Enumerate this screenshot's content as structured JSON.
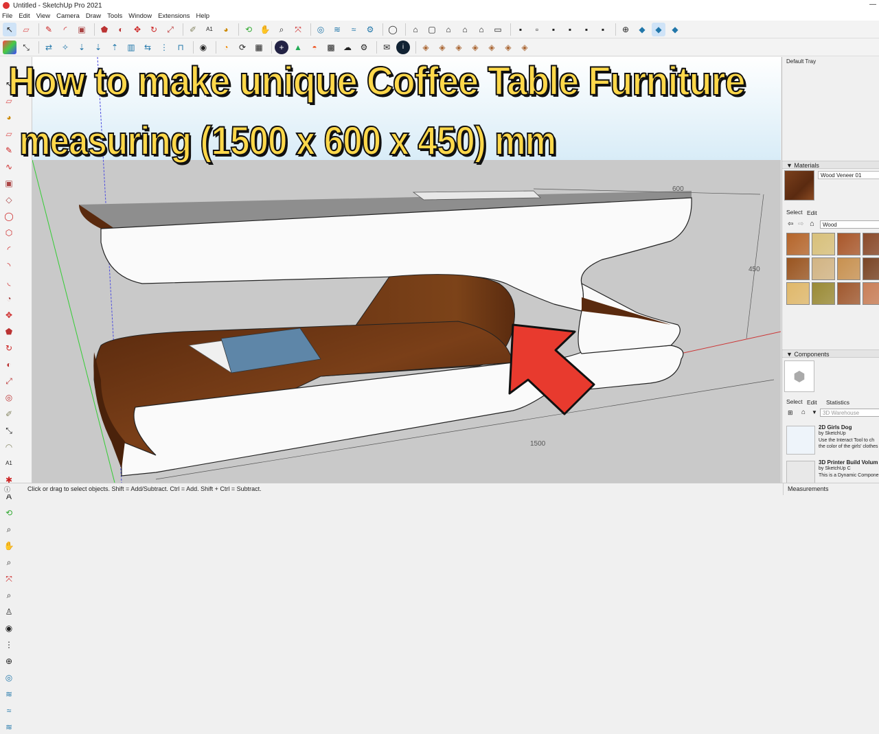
{
  "window": {
    "title": "Untitled - SketchUp Pro 2021"
  },
  "menu": [
    "File",
    "Edit",
    "View",
    "Camera",
    "Draw",
    "Tools",
    "Window",
    "Extensions",
    "Help"
  ],
  "headline": {
    "line1": "How to make unique Coffee Table Furniture",
    "line2": "measuring (1500 x 600 x 450) mm"
  },
  "dimensions": {
    "width": "1500",
    "depth": "600",
    "height": "450"
  },
  "tray": {
    "title": "Default Tray",
    "materials": {
      "header": "Materials",
      "current": "Wood Veneer 01",
      "tabs": [
        "Select",
        "Edit"
      ],
      "search": "Wood",
      "swatches": [
        "#b5652a",
        "#d8c07a",
        "#a9572a",
        "#8a4a2a",
        "#9a5520",
        "#d2b483",
        "#c89150",
        "#7a4526",
        "#e0b86a",
        "#9a8a35",
        "#a0582e",
        "#c97f58"
      ]
    },
    "components": {
      "header": "Components",
      "tabs": [
        "Select",
        "Edit",
        "Statistics"
      ],
      "search_placeholder": "3D Warehouse",
      "items": [
        {
          "title": "2D Girls Dog",
          "by": "by SketchUp",
          "desc": "Use the Interact Tool to ch",
          "desc2": "the color of the girls' clothes"
        },
        {
          "title": "3D Printer Build Volum",
          "by": "by SketchUp C",
          "desc": "This is a Dynamic Compone",
          "desc2": ""
        }
      ]
    }
  },
  "status": {
    "message": "Click or drag to select objects. Shift = Add/Subtract. Ctrl = Add. Shift + Ctrl = Subtract.",
    "measurements_label": "Measurements"
  },
  "colors": {
    "headline": "#ffd84a",
    "arrow": "#e83a2e",
    "wood": "#6b3312"
  }
}
